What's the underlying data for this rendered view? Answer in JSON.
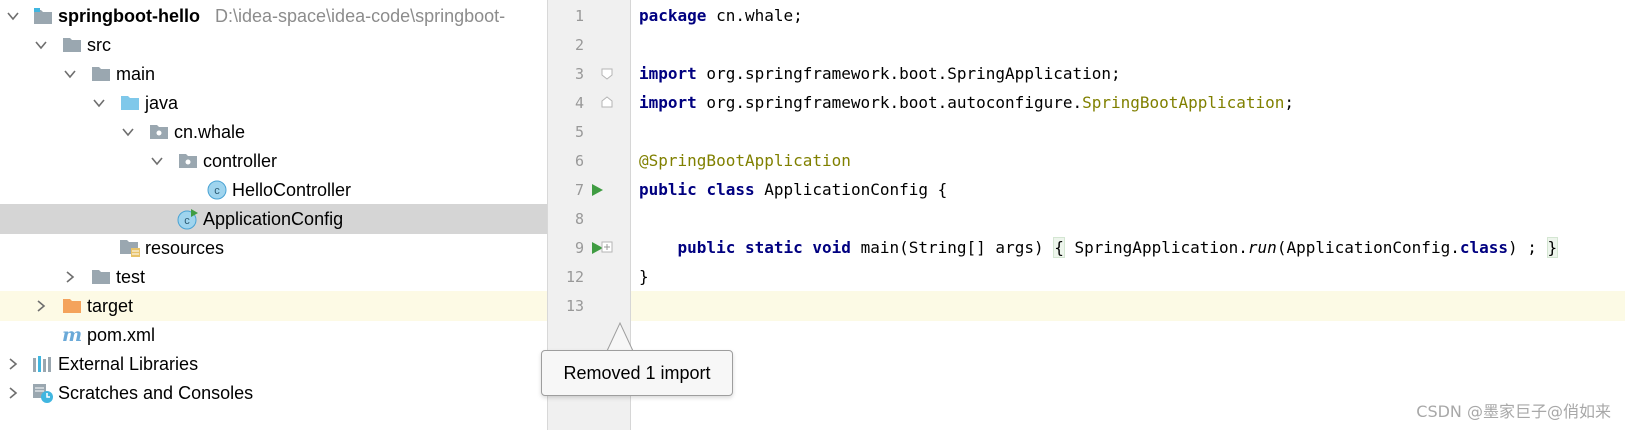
{
  "project_tree": {
    "root": {
      "name": "springboot-hello",
      "path_hint": "D:\\idea-space\\idea-code\\springboot-"
    },
    "items": [
      {
        "label": "src"
      },
      {
        "label": "main"
      },
      {
        "label": "java"
      },
      {
        "label": "cn.whale"
      },
      {
        "label": "controller"
      },
      {
        "label": "HelloController"
      },
      {
        "label": "ApplicationConfig"
      },
      {
        "label": "resources"
      },
      {
        "label": "test"
      },
      {
        "label": "target"
      },
      {
        "label": "pom.xml"
      },
      {
        "label": "External Libraries"
      },
      {
        "label": "Scratches and Consoles"
      }
    ],
    "icon_names": [
      "module-folder-icon",
      "folder-icon",
      "source-root-icon",
      "package-icon",
      "class-icon",
      "spring-boot-class-icon",
      "resources-folder-icon",
      "maven-icon",
      "libraries-icon",
      "scratches-icon"
    ]
  },
  "editor": {
    "line_numbers": [
      "1",
      "2",
      "3",
      "4",
      "5",
      "6",
      "7",
      "8",
      "9",
      "12",
      "13"
    ],
    "lines": {
      "l1": {
        "kw": "package",
        "rest": " cn.whale;"
      },
      "l3": {
        "kw": "import",
        "rest": " org.springframework.boot.SpringApplication;"
      },
      "l4": {
        "kw": "import",
        "rest": " org.springframework.boot.autoconfigure.",
        "ann": "SpringBootApplication",
        "end": ";"
      },
      "l6": {
        "ann": "@SpringBootApplication"
      },
      "l7": {
        "kw1": "public",
        "kw2": "class",
        "rest": " ApplicationConfig {"
      },
      "l9": {
        "indent": "    ",
        "kw1": "public",
        "kw2": "static",
        "kw3": "void",
        "sig": " main(String[] args) ",
        "ob": "{",
        "call": " SpringApplication.",
        "method": "run",
        "arg": "(ApplicationConfig.",
        "kw4": "class",
        "close": ") ; ",
        "cb": "}"
      },
      "l12": {
        "rest": "}"
      }
    }
  },
  "tooltip": {
    "text": "Removed 1 import"
  },
  "watermark": {
    "text": "CSDN @墨家巨子@俏如来"
  },
  "colors": {
    "keyword": "#000080",
    "annotation": "#808000",
    "selection": "#d5d5d5",
    "run_icon": "#3f9c42"
  }
}
